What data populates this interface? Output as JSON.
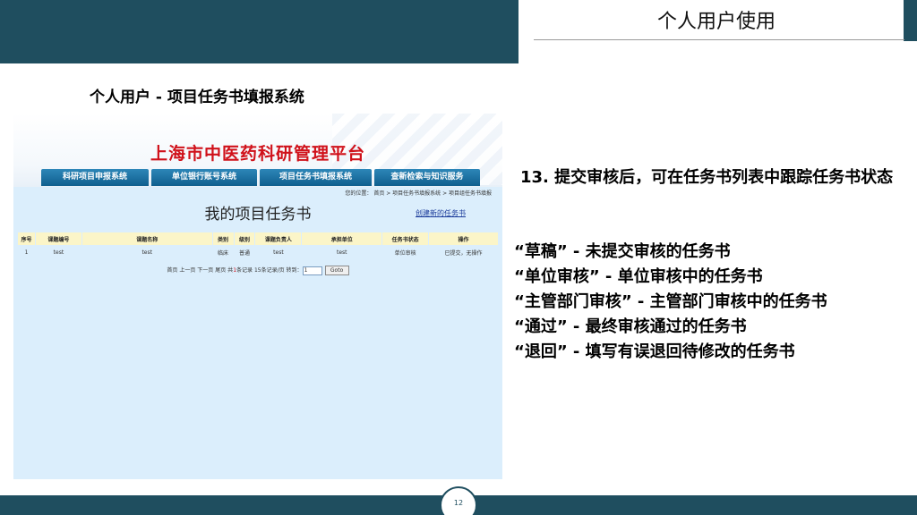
{
  "header": {
    "title": "个人用户使用"
  },
  "slide": {
    "heading": "个人用户 - 项目任务书填报系统",
    "page_number": "12"
  },
  "screenshot": {
    "platform_title": "上海市中医药科研管理平台",
    "nav_tabs": [
      "科研项目申报系统",
      "单位银行账号系统",
      "项目任务书填报系统",
      "查新检索与知识服务"
    ],
    "breadcrumb": "您的位置： 首页 > 项目任务书填报系统 > 项目组任务书填报",
    "page_title": "我的项目任务书",
    "create_link": "创建新的任务书",
    "table": {
      "columns": [
        "序号",
        "课题编号",
        "课题名称",
        "类别",
        "级别",
        "课题负责人",
        "承担单位",
        "任务书状态",
        "操作"
      ],
      "rows": [
        [
          "1",
          "test",
          "test",
          "临床",
          "普通",
          "test",
          "test",
          "单位审核",
          "已提交，无操作"
        ]
      ]
    },
    "pager": {
      "first": "首页",
      "prev": "上一页",
      "next": "下一页",
      "last": "尾页",
      "total_prefix": "共",
      "total_count": "1",
      "total_suffix": "条记录",
      "per_page": "15条记录/页",
      "jump_label": "转到：",
      "jump_value": "1",
      "go_label": "Goto"
    }
  },
  "notes": {
    "step": "13. 提交审核后，可在任务书列表中跟踪任务书状态",
    "statuses": [
      "“草稿” - 未提交审核的任务书",
      "“单位审核” - 单位审核中的任务书",
      "“主管部门审核” - 主管部门审核中的任务书",
      "“通过” - 最终审核通过的任务书",
      "“退回” - 填写有误退回待修改的任务书"
    ]
  },
  "colors": {
    "brand_dark": "#1f4e5f",
    "platform_red": "#d0111a",
    "table_header": "#fbf5c8",
    "content_bg": "#dbeefc"
  }
}
